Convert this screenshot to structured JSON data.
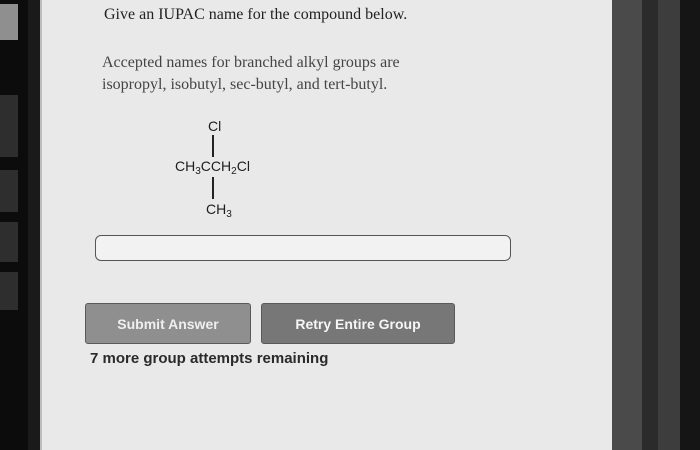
{
  "question": {
    "title": "Give an IUPAC name for the compound below.",
    "hint_line1": "Accepted names for branched alkyl groups are",
    "hint_line2": "isopropyl, isobutyl, sec-butyl, and tert-butyl."
  },
  "structure": {
    "top_atom": "Cl",
    "main_prefix": "CH",
    "main_sub1": "3",
    "main_center": "CCH",
    "main_sub2": "2",
    "main_suffix": "Cl",
    "bottom_main": "CH",
    "bottom_sub": "3"
  },
  "answer": {
    "value": "",
    "placeholder": ""
  },
  "buttons": {
    "submit_label": "Submit Answer",
    "retry_label": "Retry Entire Group"
  },
  "status": {
    "attempts_text": "7 more group attempts remaining"
  }
}
